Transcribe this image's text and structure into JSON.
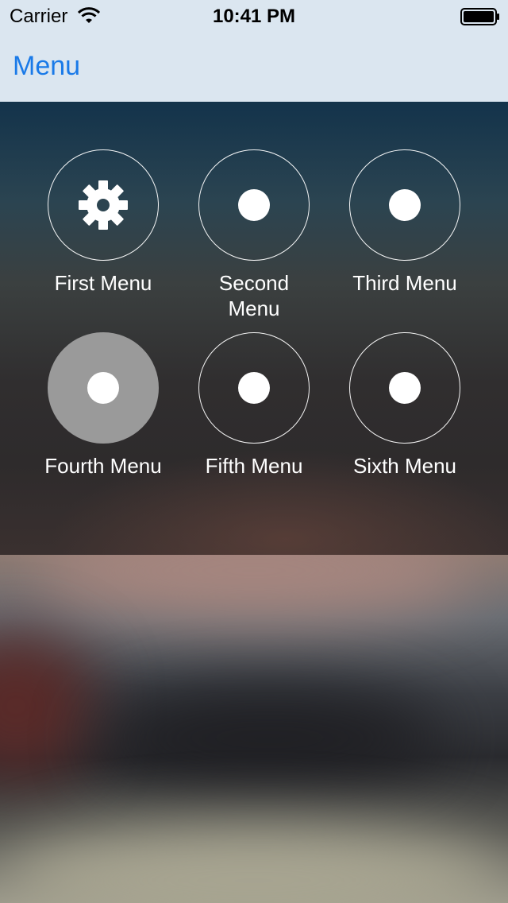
{
  "status_bar": {
    "carrier": "Carrier",
    "time": "10:41 PM",
    "wifi_icon": "wifi-icon",
    "battery_icon": "battery-icon"
  },
  "nav": {
    "menu_label": "Menu"
  },
  "menu": {
    "items": [
      {
        "label": "First Menu",
        "icon": "gear-icon",
        "highlighted": false
      },
      {
        "label": "Second\nMenu",
        "icon": "dot-icon",
        "highlighted": false
      },
      {
        "label": "Third Menu",
        "icon": "dot-icon",
        "highlighted": false
      },
      {
        "label": "Fourth Menu",
        "icon": "dot-icon",
        "highlighted": true
      },
      {
        "label": "Fifth Menu",
        "icon": "dot-icon",
        "highlighted": false
      },
      {
        "label": "Sixth Menu",
        "icon": "dot-icon",
        "highlighted": false
      }
    ]
  },
  "colors": {
    "nav_background": "#dbe6f0",
    "accent": "#1a7ae8",
    "highlight_fill": "#9a9a9a"
  }
}
